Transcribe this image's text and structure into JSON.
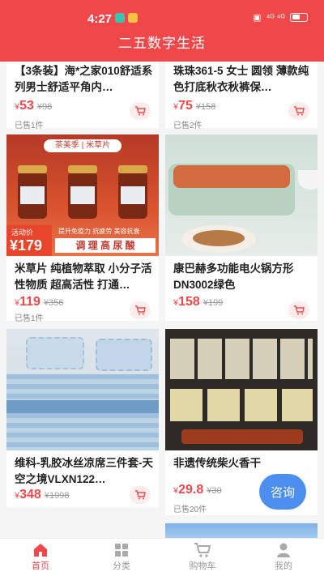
{
  "status": {
    "time": "4:27",
    "signal": "⁴ᴳ ⁴ᴳ"
  },
  "header": {
    "title": "二五数字生活"
  },
  "products": [
    {
      "title": "【3条装】海*之家010舒适系列男士舒适平角内…",
      "currency": "¥",
      "price": "53",
      "original": "¥98",
      "sold": "已售1件"
    },
    {
      "title": "珠珠361-5 女士 圆领 薄款纯色打底秋衣秋裤保…",
      "currency": "¥",
      "price": "75",
      "original": "¥158",
      "sold": "已售2件"
    },
    {
      "title": "米草片 纯植物萃取 小分子活性物质 超高活性 打通…",
      "currency": "¥",
      "price": "119",
      "original": "¥356",
      "sold": "已售1件",
      "image_text": {
        "brand": "茶美季 | 米草片",
        "promo_label": "活动价",
        "promo_price": "¥179",
        "tags": "提升免疫力 抗疲劳 美容抗衰",
        "banner": "调 理 高 尿 酸"
      }
    },
    {
      "title": "康巴赫多功能电火锅方形DN3002绿色",
      "currency": "¥",
      "price": "158",
      "original": "¥199",
      "sold": ""
    },
    {
      "title": "维科-乳胶冰丝凉席三件套-天空之境VLXN122…",
      "currency": "¥",
      "price": "348",
      "original": "¥1998",
      "sold": ""
    },
    {
      "title": "非遗传统柴火香干",
      "currency": "¥",
      "price": "29.8",
      "original": "¥30",
      "sold": "已售20件"
    }
  ],
  "float_button": {
    "label": "咨询"
  },
  "tabbar": [
    {
      "label": "首页",
      "icon": "home-icon",
      "active": true
    },
    {
      "label": "分类",
      "icon": "category-icon",
      "active": false
    },
    {
      "label": "购物车",
      "icon": "cart-icon",
      "active": false
    },
    {
      "label": "我的",
      "icon": "user-icon",
      "active": false
    }
  ],
  "colors": {
    "brand": "#f0484a",
    "consult": "#4d8ff0"
  }
}
